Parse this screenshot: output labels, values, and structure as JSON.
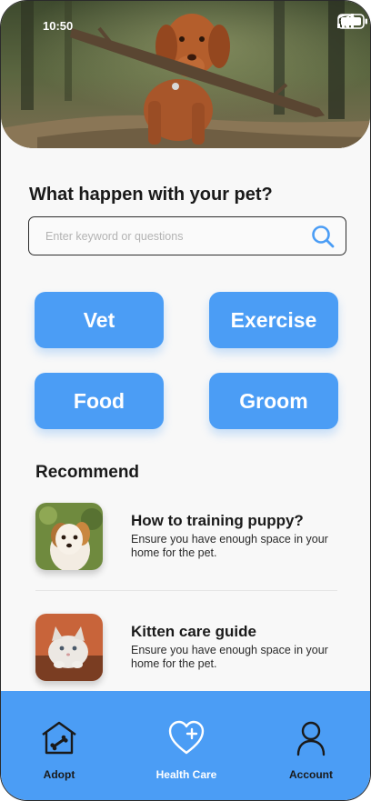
{
  "status_bar": {
    "time": "10:50",
    "icons": [
      "signal-icon",
      "wifi-icon",
      "battery-icon"
    ]
  },
  "hero": {
    "image": "dog-with-stick-photo"
  },
  "question": "What happen with your pet?",
  "search": {
    "placeholder": "Enter keyword or questions",
    "value": "",
    "icon": "search-icon"
  },
  "categories": [
    {
      "label": "Vet"
    },
    {
      "label": "Exercise"
    },
    {
      "label": "Food"
    },
    {
      "label": "Groom"
    }
  ],
  "recommend": {
    "title": "Recommend",
    "items": [
      {
        "title": "How to training puppy?",
        "description": "Ensure you have enough space in your home for the pet.",
        "image": "puppy-photo"
      },
      {
        "title": "Kitten care guide",
        "description": "Ensure you have enough space in your home for the pet.",
        "image": "kitten-photo"
      }
    ]
  },
  "bottom_nav": {
    "items": [
      {
        "label": "Adopt",
        "icon": "house-bone-icon",
        "color": "#1a1a1a"
      },
      {
        "label": "Health Care",
        "icon": "heart-plus-icon",
        "color": "#ffffff"
      },
      {
        "label": "Account",
        "icon": "user-icon",
        "color": "#1a1a1a"
      }
    ]
  },
  "colors": {
    "accent": "#4b9df5",
    "text": "#1a1a1a",
    "background": "#f8f8f8"
  }
}
